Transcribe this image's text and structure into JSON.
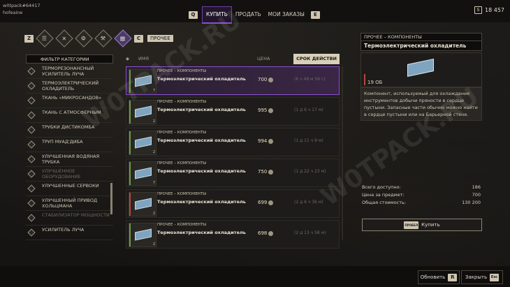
{
  "user": {
    "name": "w0tpack#64417",
    "status": "hofeaine"
  },
  "nav": {
    "left_key": "Q",
    "tabs": [
      "КУПИТЬ",
      "ПРОДАТЬ",
      "МОИ ЗАКАЗЫ"
    ],
    "active_tab": 0,
    "right_key": "E"
  },
  "balance": {
    "icon": "solari-icon",
    "value": "18 457"
  },
  "categories": {
    "left_key": "Z",
    "right_key": "C",
    "label": "ПРОЧЕЕ",
    "icons": [
      "all-icon",
      "weapon-icon",
      "tools-icon",
      "armor-icon",
      "hammer-icon",
      "misc-icon"
    ],
    "selected": 5
  },
  "filter": {
    "header": "ФИЛЬТР КАТЕГОРИИ",
    "items": [
      "ТЕРМОРЕЗОНАНСНЫЙ УСИЛИТЕЛЬ ЛУЧА",
      "ТЕРМОЭЛЕКТРИЧЕСКИЙ ОХЛАДИТЕЛЬ",
      "ТКАНЬ «МИКРОСАНДОВ»",
      "ТКАНЬ С АТМОСФЕРНЫМ",
      "ТРУБКИ ДИСТИКОМБА",
      "ТРУП МУАД'ДИБА",
      "УЛУЧШЕННАЯ ВОДЯНАЯ ТРУБКА",
      "УЛУЧШЕННОЕ ОБОРУДОВАНИЕ",
      "УЛУЧШЕННЫЕ СЕРВОКИ",
      "УЛУЧШЕННЫЙ ПРИВОД ХОЛЬЦМАНА",
      "СТАБИЛИЗАТОР МОЩНОСТИ",
      "УСИЛИТЕЛЬ ЛУЧА"
    ]
  },
  "table": {
    "columns": [
      "ИМЯ",
      "ЦЕНА",
      "СРОК ДЕЙСТВИ"
    ],
    "rows": [
      {
        "category": "ПРОЧЕЕ – КОМПОНЕНТЫ",
        "name": "Термоэлектрический охладитель",
        "price": "700",
        "time": "(6 ч 48 м 56 с)",
        "qty": "7",
        "bar": "green"
      },
      {
        "category": "ПРОЧЕЕ – КОМПОНЕНТЫ",
        "name": "Термоэлектрический охладитель",
        "price": "995",
        "time": "(1 д 6 ч 17 м)",
        "qty": "2",
        "bar": "green"
      },
      {
        "category": "ПРОЧЕЕ – КОМПОНЕНТЫ",
        "name": "Термоэлектрический охладитель",
        "price": "994",
        "time": "(1 д 11 ч 9 м)",
        "qty": "2",
        "bar": "green"
      },
      {
        "category": "ПРОЧЕЕ – КОМПОНЕНТЫ",
        "name": "Термоэлектрический охладитель",
        "price": "750",
        "time": "(1 д 22 ч 23 м)",
        "qty": "7",
        "bar": "green"
      },
      {
        "category": "ПРОЧЕЕ – КОМПОНЕНТЫ",
        "name": "Термоэлектрический охладитель",
        "price": "699",
        "time": "(2 д 6 ч 36 м)",
        "qty": "2",
        "bar": "red"
      },
      {
        "category": "ПРОЧЕЕ – КОМПОНЕНТЫ",
        "name": "Термоэлектрический охладитель",
        "price": "698",
        "time": "(2 д 13 ч 58 м)",
        "qty": "2",
        "bar": "green"
      }
    ]
  },
  "detail": {
    "category": "ПРОЧЕЕ – КОМПОНЕНТЫ",
    "title": "Термоэлектрический охладитель",
    "volume": "19 ОБ",
    "description": "Компонент, используемый для охлаждения инструментов добычи пряности в сердце пустыни. Запасные части обычно можно найти в сердце пустыни или на Барьерной стене."
  },
  "stats": {
    "available_label": "Всего доступно:",
    "available": "186",
    "unit_label": "Цена за предмет:",
    "unit": "700",
    "total_label": "Общая стоимость:",
    "total": "130 200"
  },
  "buy": {
    "key": "ПРОБЕЛ",
    "label": "Купить"
  },
  "bottom": {
    "refresh_label": "Обновить",
    "refresh_key": "R",
    "close_label": "Закрыть",
    "close_key": "Esc"
  },
  "watermark": "W0TPACK.RU",
  "colors": {
    "accent": "#8a4fd0",
    "panel": "#1e1c1a",
    "text": "#cfc8b8"
  }
}
